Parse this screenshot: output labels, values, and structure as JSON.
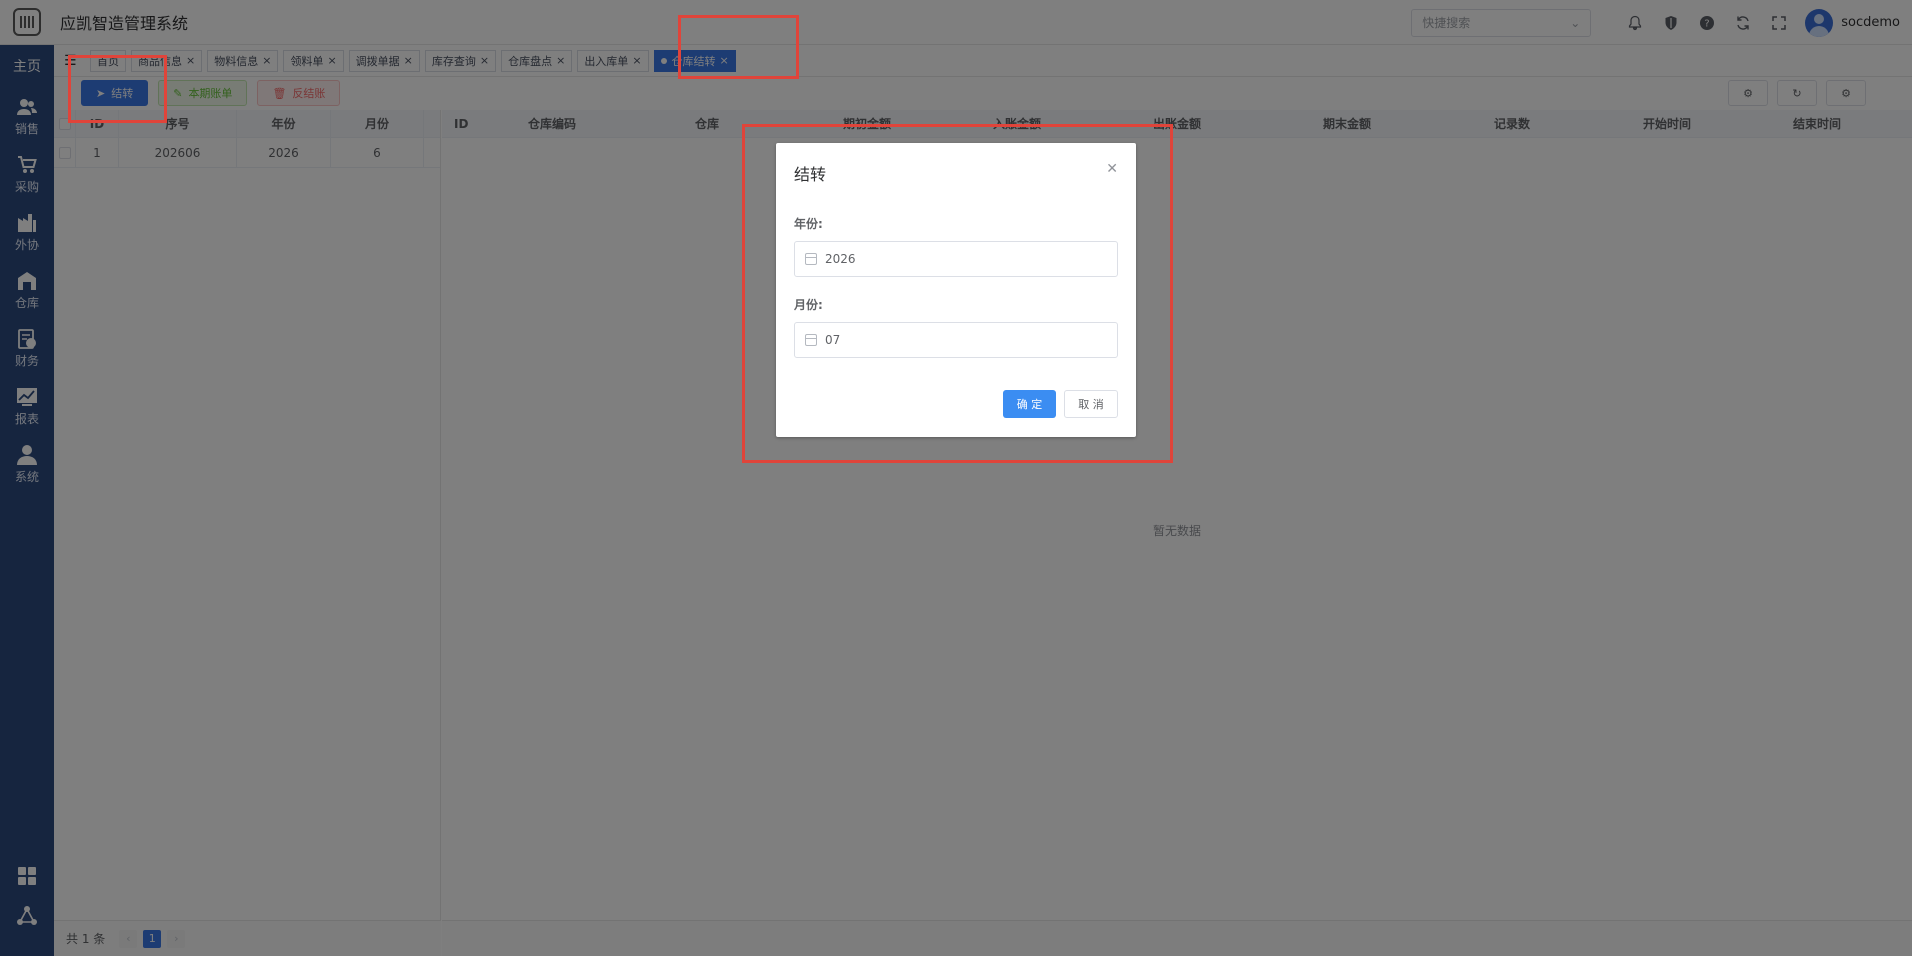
{
  "app": {
    "title": "应凯智造管理系统"
  },
  "header": {
    "search_placeholder": "快捷搜索",
    "username": "socdemo"
  },
  "sidebar": {
    "home": "主页",
    "items": [
      {
        "label": "销售",
        "icon": "users-icon"
      },
      {
        "label": "采购",
        "icon": "cart-icon"
      },
      {
        "label": "外协",
        "icon": "factory-icon"
      },
      {
        "label": "仓库",
        "icon": "warehouse-icon"
      },
      {
        "label": "财务",
        "icon": "finance-icon"
      },
      {
        "label": "报表",
        "icon": "chart-icon"
      },
      {
        "label": "系统",
        "icon": "user-icon"
      }
    ]
  },
  "tabs": [
    {
      "label": "首页"
    },
    {
      "label": "商品信息"
    },
    {
      "label": "物料信息"
    },
    {
      "label": "领料单"
    },
    {
      "label": "调拨单据"
    },
    {
      "label": "库存查询"
    },
    {
      "label": "仓库盘点"
    },
    {
      "label": "出入库单"
    },
    {
      "label": "仓库结转",
      "active": true
    }
  ],
  "toolbar": {
    "carryover": "结转",
    "period_bills": "本期账单",
    "reverse": "反结账"
  },
  "left_table": {
    "headers": [
      "ID",
      "序号",
      "年份",
      "月份"
    ],
    "rows": [
      {
        "id": "1",
        "seq": "202606",
        "year": "2026",
        "month": "6"
      }
    ]
  },
  "right_table": {
    "headers": [
      "ID",
      "仓库编码",
      "仓库",
      "期初金额",
      "入账金额",
      "出账金额",
      "期末金额",
      "记录数",
      "开始时间",
      "结束时间"
    ],
    "empty": "暂无数据"
  },
  "pagination": {
    "total": "共 1 条",
    "current": "1"
  },
  "dialog": {
    "title": "结转",
    "year_label": "年份:",
    "year_value": "2026",
    "month_label": "月份:",
    "month_value": "07",
    "ok": "确 定",
    "cancel": "取 消"
  },
  "colors": {
    "sidebar": "#2c4a7e",
    "primary": "#3b78e7",
    "annotation": "#e0443a"
  }
}
